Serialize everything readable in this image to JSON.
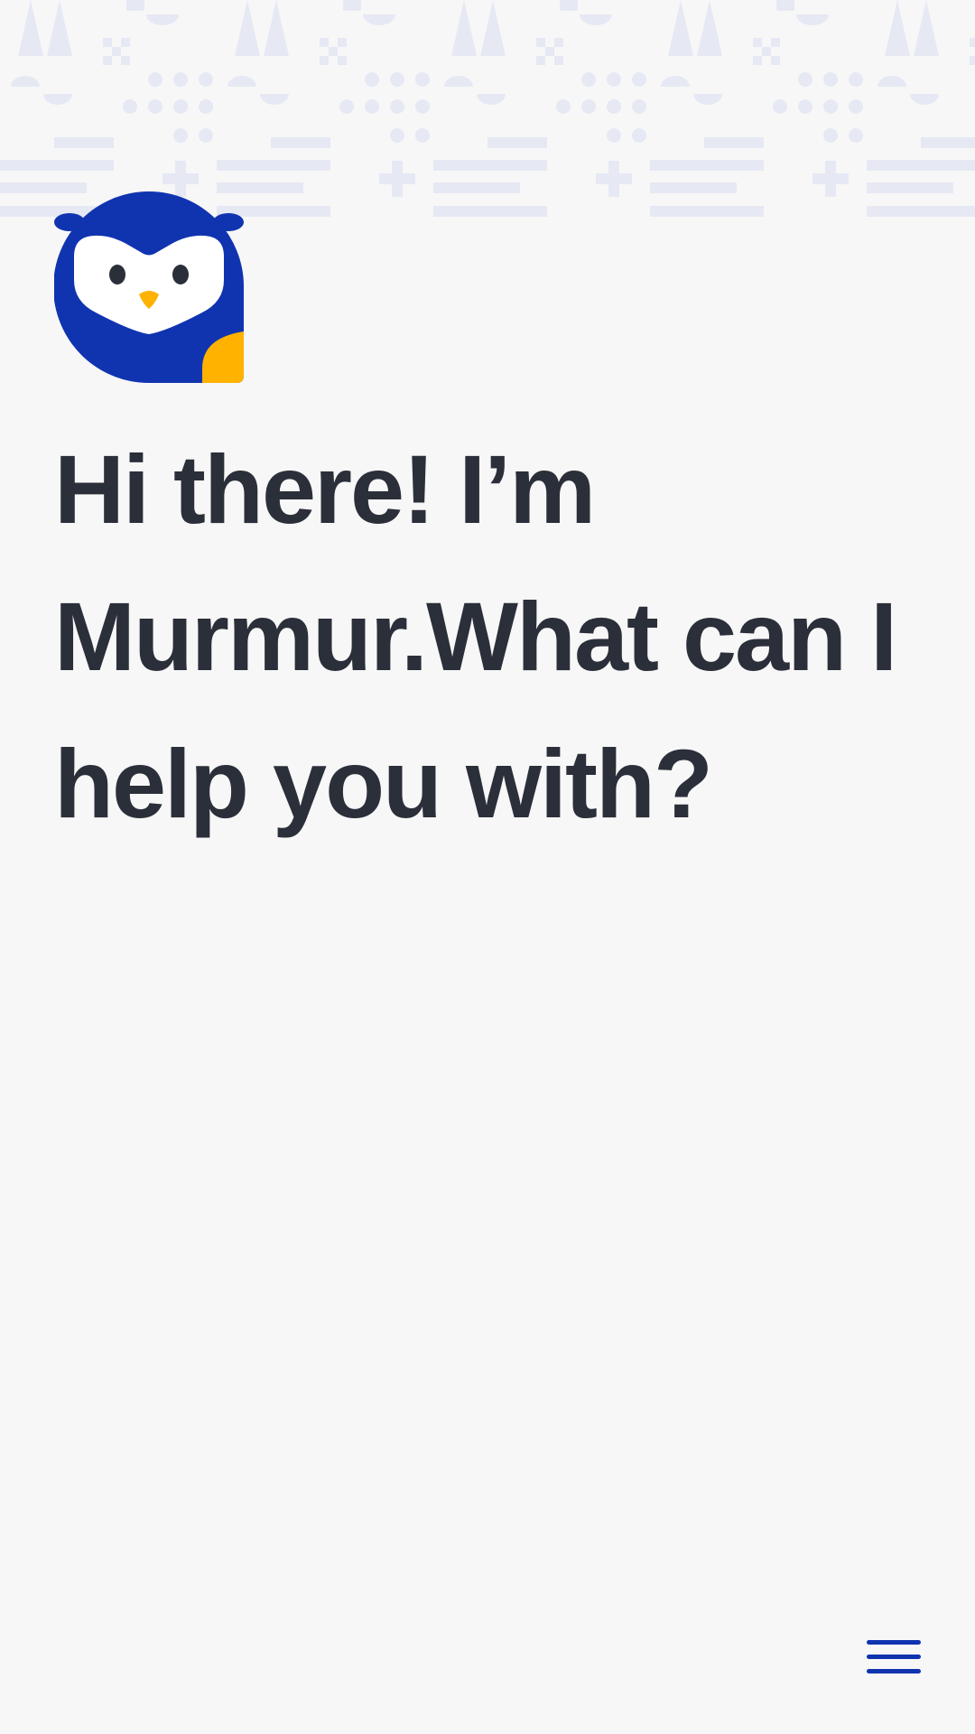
{
  "theme": {
    "background": "#f7f7f7",
    "pattern_color": "#e6e9f4",
    "brand_blue": "#1034b0",
    "brand_yellow": "#ffb200",
    "text_color": "#2b2f3a"
  },
  "header": {
    "mascot_icon": "owl-mascot-icon",
    "pattern": "decorative-geometric-pattern"
  },
  "main": {
    "greeting": "Hi there! I’m Murmur.What can I help you with?"
  },
  "menu": {
    "icon": "hamburger-menu-icon"
  }
}
